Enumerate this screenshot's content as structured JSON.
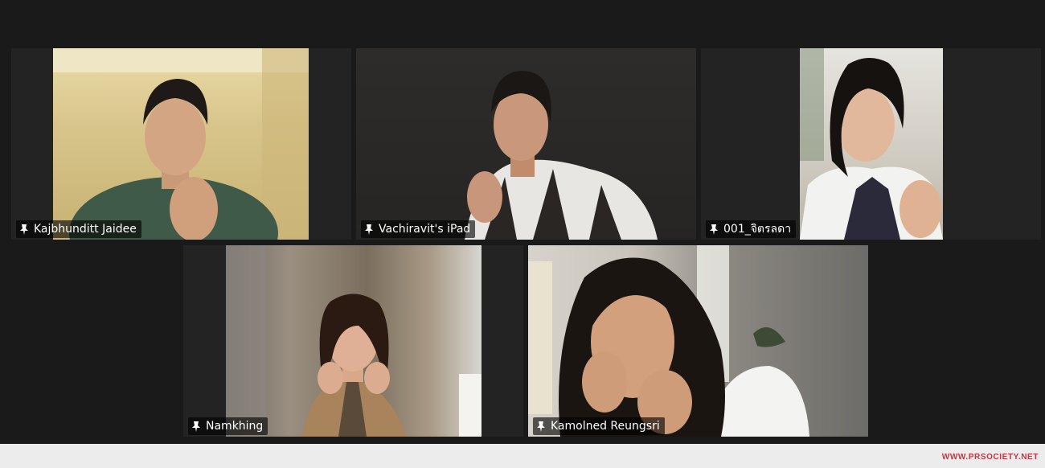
{
  "meeting": {
    "participants": [
      {
        "name": "Kajbhunditt Jaidee",
        "pinned_icon": "pin-icon"
      },
      {
        "name": "Vachiravit's iPad",
        "pinned_icon": "pin-icon"
      },
      {
        "name": "001_จิตรลดา",
        "pinned_icon": "pin-icon"
      },
      {
        "name": "Namkhing",
        "pinned_icon": "pin-icon"
      },
      {
        "name": "Kamolned Reungsri",
        "pinned_icon": "pin-icon"
      }
    ]
  },
  "watermark": {
    "text": "WWW.PRSOCIETY.NET",
    "color": "#d0303c"
  },
  "colors": {
    "background": "#1a1a1a",
    "tile": "#232323",
    "name_tag_text": "#ffffff"
  }
}
